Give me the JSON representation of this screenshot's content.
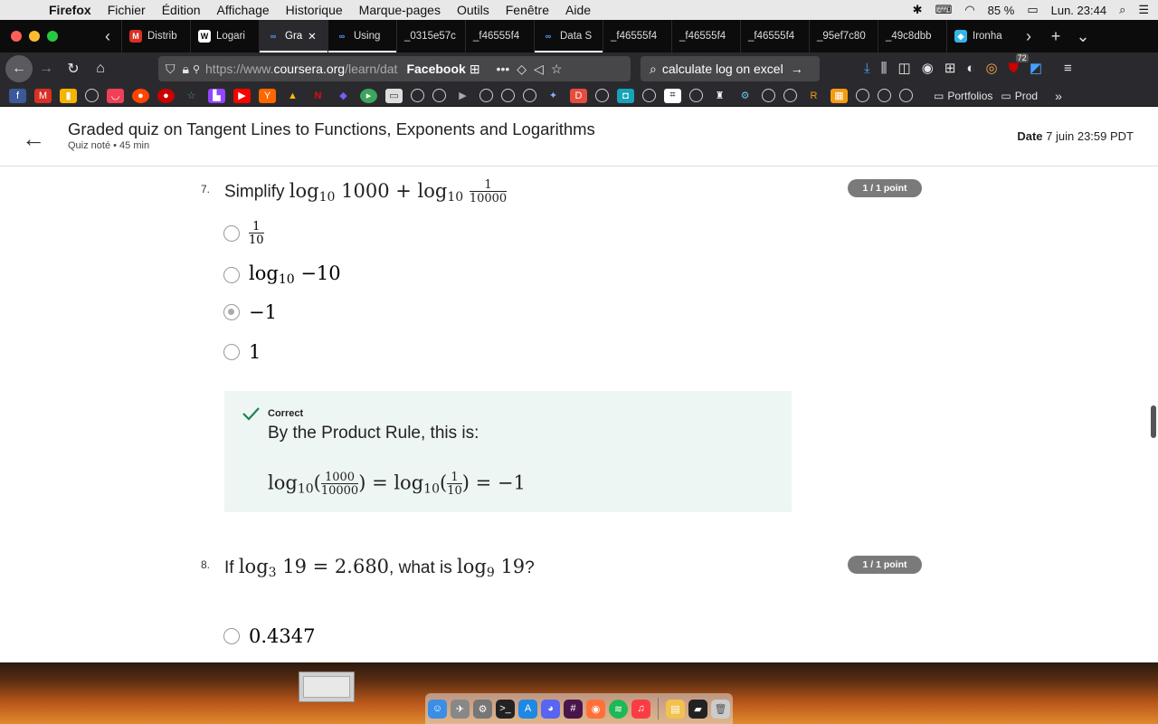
{
  "menubar": {
    "app": "Firefox",
    "items": [
      "Fichier",
      "Édition",
      "Affichage",
      "Historique",
      "Marque-pages",
      "Outils",
      "Fenêtre",
      "Aide"
    ],
    "battery": "85 %",
    "clock": "Lun. 23:44"
  },
  "tabs": [
    {
      "label": "Distrib",
      "icon": "gmail-icon",
      "color": "#d93025",
      "glyph": "M"
    },
    {
      "label": "Logari",
      "icon": "wikipedia-icon",
      "color": "#ffffff",
      "glyph": "W"
    },
    {
      "label": "Gra",
      "icon": "coursera-icon",
      "color": "#2a73cc",
      "glyph": "∞",
      "active": true
    },
    {
      "label": "Using",
      "icon": "coursera-icon",
      "color": "#2a73cc",
      "glyph": "∞"
    },
    {
      "label": "_0315e57c",
      "icon": "",
      "color": "",
      "glyph": ""
    },
    {
      "label": "_f46555f4",
      "icon": "",
      "color": "",
      "glyph": ""
    },
    {
      "label": "Data S",
      "icon": "coursera-icon",
      "color": "#2a73cc",
      "glyph": "∞"
    },
    {
      "label": "_f46555f4",
      "icon": "",
      "color": "",
      "glyph": ""
    },
    {
      "label": "_f46555f4",
      "icon": "",
      "color": "",
      "glyph": ""
    },
    {
      "label": "_f46555f4",
      "icon": "",
      "color": "",
      "glyph": ""
    },
    {
      "label": "_95ef7c80",
      "icon": "",
      "color": "",
      "glyph": ""
    },
    {
      "label": "_49c8dbb",
      "icon": "",
      "color": "",
      "glyph": ""
    },
    {
      "label": "Ironha",
      "icon": "ironhack-icon",
      "color": "#32b6e8",
      "glyph": "◆"
    }
  ],
  "nav": {
    "url_prefix": "https://www.",
    "url_host": "coursera.org",
    "url_path": "/learn/dat",
    "bookmark_chip": "Facebook",
    "search_text": "calculate log on excel",
    "badge_count": "72"
  },
  "bookmarks": {
    "folders": [
      "Portfolios",
      "Prod"
    ]
  },
  "quiz": {
    "title": "Graded quiz on Tangent Lines to Functions, Exponents and Logarithms",
    "subtitle": "Quiz noté • 45  min",
    "date_label": "Date",
    "date_value": "7 juin 23:59 PDT"
  },
  "q7": {
    "number": "7.",
    "prompt": "Simplify",
    "points": "1 / 1 point",
    "options": [
      "1/10",
      "log10 −10",
      "−1",
      "1"
    ],
    "selected_index": 2,
    "feedback_label": "Correct",
    "feedback_text": "By the Product Rule, this is:"
  },
  "q8": {
    "number": "8.",
    "prompt_prefix": "If",
    "prompt_mid": ", what is",
    "prompt_suffix": "?",
    "points": "1 / 1 point",
    "first_option": "0.4347"
  },
  "colors": {
    "correct_green": "#1f8354",
    "feedback_bg": "#eef6f3",
    "points_badge": "#7a7a7a"
  }
}
